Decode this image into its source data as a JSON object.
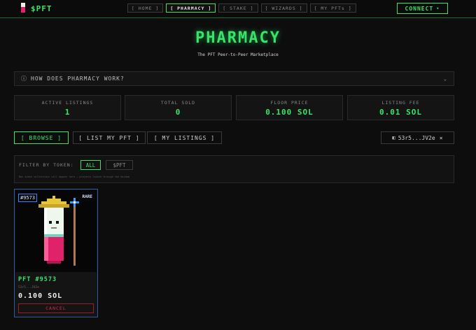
{
  "brand": {
    "name": "$PFT"
  },
  "nav": {
    "items": [
      "[ HOME ]",
      "[ PHARMACY ]",
      "[ STAKE ]",
      "[ WIZARDS ]",
      "[ MY PFTs ]"
    ]
  },
  "connect": {
    "label": "CONNECT"
  },
  "page": {
    "title": "PHARMACY",
    "subtitle": "The PFT Peer-to-Peer Marketplace"
  },
  "faq": {
    "label": "HOW DOES PHARMACY WORK?"
  },
  "stats": [
    {
      "label": "ACTIVE LISTINGS",
      "value": "1"
    },
    {
      "label": "TOTAL SOLD",
      "value": "0"
    },
    {
      "label": "FLOOR PRICE",
      "value": "0.100 SOL"
    },
    {
      "label": "LISTING FEE",
      "value": "0.01 SOL"
    }
  ],
  "tabs": [
    "[ BROWSE ]",
    "[ LIST MY PFT ]",
    "[ MY LISTINGS ]"
  ],
  "wallet": {
    "address": "53r5...JV2e"
  },
  "filter": {
    "label": "FILTER BY TOKEN:",
    "options": [
      "ALL",
      "$PFT"
    ],
    "note": "Non-token collections will appear here — projects launch through the Wizdom"
  },
  "listing": {
    "id": "#9573",
    "rarity": "RARE",
    "name": "PFT #9573",
    "seller": "53r5...JV2e",
    "price": "0.100 SOL",
    "action": "CANCEL"
  },
  "colors": {
    "accent": "#39e36b",
    "card_border": "#2d5aa0",
    "danger": "#e0284a",
    "pill_body": "#e0226b"
  }
}
